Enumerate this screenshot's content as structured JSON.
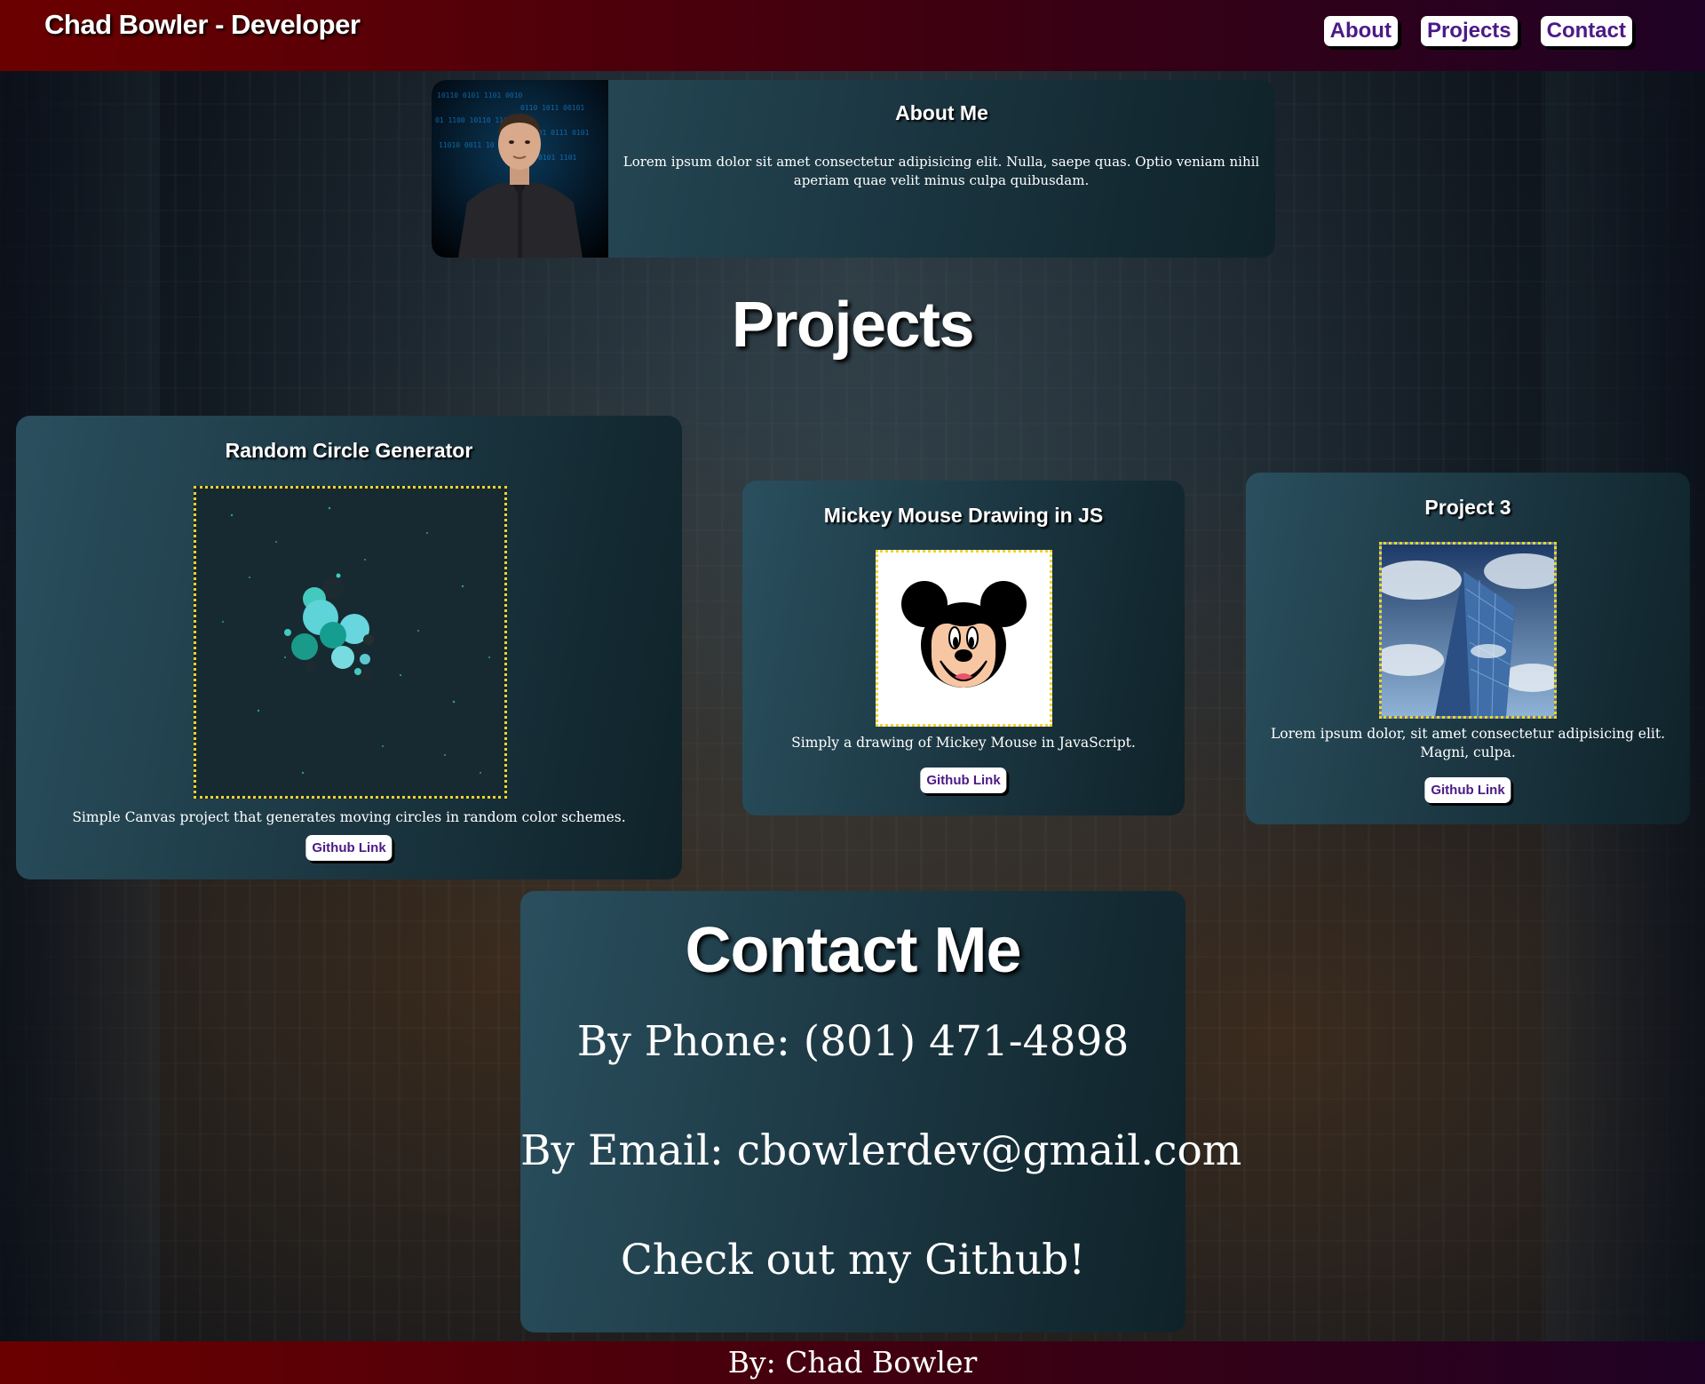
{
  "header": {
    "title": "Chad Bowler - Developer",
    "nav": [
      "About",
      "Projects",
      "Contact"
    ]
  },
  "about": {
    "title": "About Me",
    "text": "Lorem ipsum dolor sit amet consectetur adipisicing elit. Nulla, saepe quas. Optio veniam nihil aperiam quae velit minus culpa quibusdam."
  },
  "projects": {
    "heading": "Projects",
    "items": [
      {
        "title": "Random Circle Generator",
        "description": "Simple Canvas project that generates moving circles in random color schemes.",
        "link_label": "Github Link"
      },
      {
        "title": "Mickey Mouse Drawing in JS",
        "description": "Simply a drawing of Mickey Mouse in JavaScript.",
        "link_label": "Github Link"
      },
      {
        "title": "Project 3",
        "description": "Lorem ipsum dolor, sit amet consectetur adipisicing elit. Magni, culpa.",
        "link_label": "Github Link"
      }
    ]
  },
  "contact": {
    "title": "Contact Me",
    "phone": "By Phone: (801) 471-4898",
    "email": "By Email: cbowlerdev@gmail.com",
    "github": "Check out my Github!"
  },
  "footer": {
    "text": "By: Chad Bowler"
  },
  "colors": {
    "header_start": "#6b0000",
    "header_end": "#1f0225",
    "card": "#1b3641",
    "nav_text": "#4b1a86",
    "thumb_border": "#f1d32a"
  }
}
